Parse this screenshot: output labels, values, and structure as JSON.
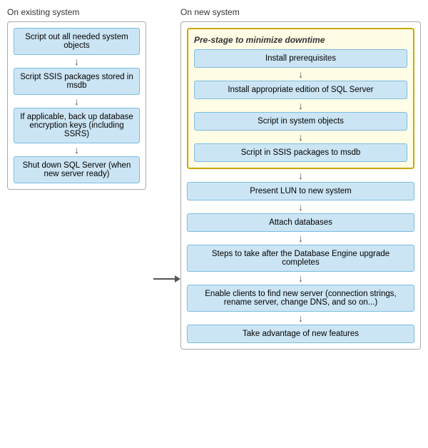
{
  "headers": {
    "left": "On existing system",
    "right": "On new system"
  },
  "left_steps": [
    "Script out all needed system objects",
    "Script SSIS packages stored in msdb",
    "If applicable, back up database encryption keys (including SSRS)",
    "Shut down SQL Server (when new server ready)"
  ],
  "prestage_title": "Pre-stage to minimize downtime",
  "prestage_steps": [
    "Install prerequisites",
    "Install appropriate edition of SQL Server",
    "Script in system objects",
    "Script in SSIS packages to msdb"
  ],
  "right_steps": [
    "Present LUN to new system",
    "Attach databases",
    "Steps to take after the Database Engine upgrade completes",
    "Enable clients to find new server (connection strings, rename server, change DNS, and so on...)",
    "Take advantage of new features"
  ],
  "arrow_symbol": "↓",
  "h_arrow": "→"
}
